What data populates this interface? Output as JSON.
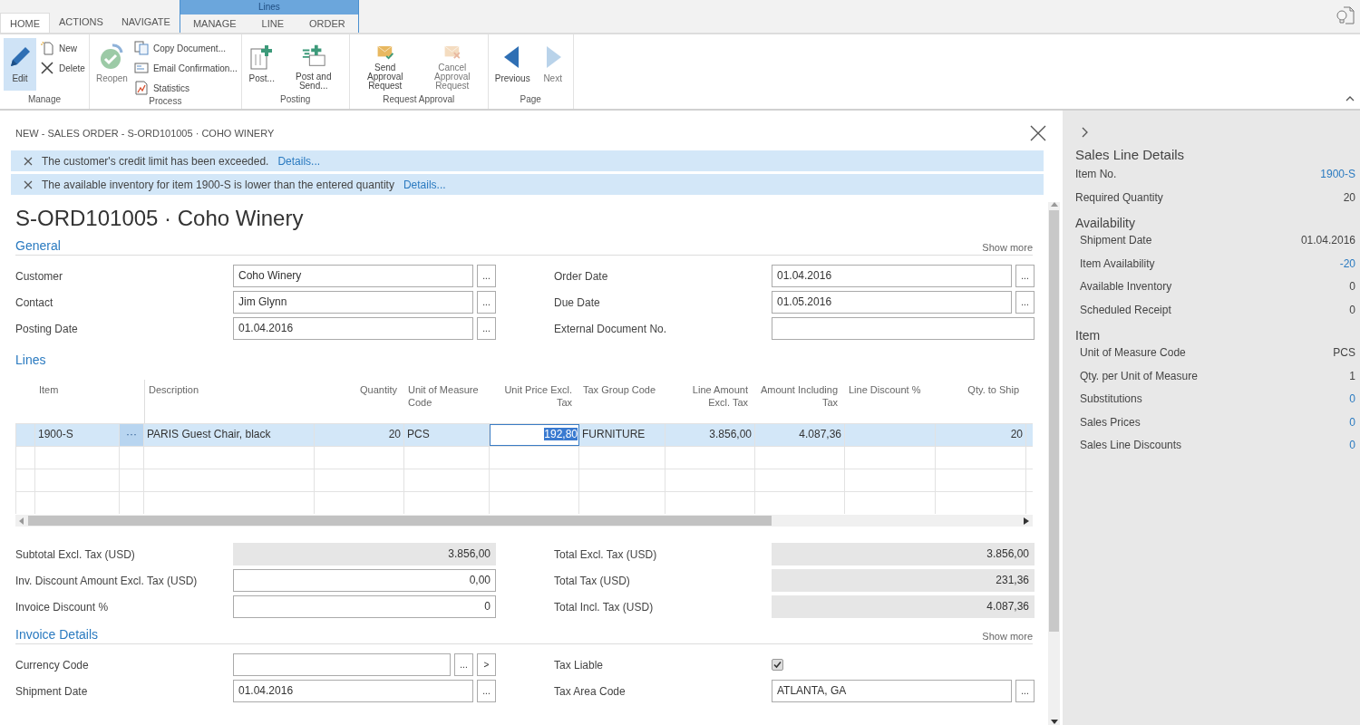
{
  "ribbon": {
    "tabs": [
      {
        "label": "HOME",
        "selected": true
      },
      {
        "label": "ACTIONS",
        "selected": false
      },
      {
        "label": "NAVIGATE",
        "selected": false
      }
    ],
    "context_tabs": {
      "title": "Lines",
      "tabs": [
        {
          "label": "MANAGE",
          "selected": false
        },
        {
          "label": "LINE",
          "selected": false
        },
        {
          "label": "ORDER",
          "selected": false
        }
      ]
    },
    "groups": [
      {
        "label": "Manage",
        "actions": [
          {
            "label": "Edit",
            "large": true,
            "kind": "pencil",
            "selected": true,
            "disabled": false
          },
          {
            "label": "New",
            "large": false,
            "kind": "new"
          },
          {
            "label": "Delete",
            "large": false,
            "kind": "delete"
          }
        ]
      },
      {
        "label": "Process",
        "actions": [
          {
            "label": "Reopen",
            "large": true,
            "kind": "reopen",
            "selected": false,
            "disabled": true
          },
          {
            "label": "Copy Document...",
            "large": false,
            "kind": "copy"
          },
          {
            "label": "Email Confirmation...",
            "large": false,
            "kind": "email"
          },
          {
            "label": "Statistics",
            "large": false,
            "kind": "stats"
          }
        ]
      },
      {
        "label": "Posting",
        "actions": [
          {
            "label": "Post...",
            "large": true,
            "kind": "post",
            "selected": false,
            "disabled": false
          },
          {
            "label": "Post and Send...",
            "large": true,
            "kind": "postsend",
            "selected": false,
            "disabled": false
          }
        ]
      },
      {
        "label": "Request Approval",
        "actions": [
          {
            "label": "Send Approval Request",
            "large": true,
            "kind": "sendapproval",
            "selected": false,
            "disabled": false
          },
          {
            "label": "Cancel Approval Request",
            "large": true,
            "kind": "cancelapproval",
            "selected": false,
            "disabled": true
          }
        ]
      },
      {
        "label": "Page",
        "actions": [
          {
            "label": "Previous",
            "large": true,
            "kind": "prev",
            "selected": false,
            "disabled": false
          },
          {
            "label": "Next",
            "large": true,
            "kind": "next",
            "selected": false,
            "disabled": true
          }
        ]
      }
    ]
  },
  "breadcrumb": "NEW - SALES ORDER - S-ORD101005 · COHO WINERY",
  "notifications": [
    {
      "text": "The customer's credit limit has been exceeded.",
      "link": "Details..."
    },
    {
      "text": "The available inventory for item 1900-S is lower than the entered quantity",
      "link": "Details..."
    }
  ],
  "title": "S-ORD101005 · Coho Winery",
  "general": {
    "heading": "General",
    "show_more": "Show more",
    "fields": [
      {
        "label": "Customer",
        "value": "Coho Winery",
        "lookup": "..."
      },
      {
        "label": "Order Date",
        "value": "01.04.2016",
        "lookup": "..."
      },
      {
        "label": "Contact",
        "value": "Jim Glynn",
        "lookup": "..."
      },
      {
        "label": "Due Date",
        "value": "01.05.2016",
        "lookup": "..."
      },
      {
        "label": "Posting Date",
        "value": "01.04.2016",
        "lookup": "..."
      },
      {
        "label": "External Document No."
      }
    ]
  },
  "lines": {
    "heading": "Lines",
    "columns": [
      {
        "label": "Item",
        "right_aligned": false
      },
      {
        "right_aligned": false
      },
      {
        "label": "Description",
        "right_aligned": false
      },
      {
        "label": "Quantity",
        "right_aligned": true
      },
      {
        "label": "Unit of Measure Code",
        "right_aligned": false
      },
      {
        "label": "Unit Price Excl. Tax",
        "right_aligned": true
      },
      {
        "label": "Tax Group Code",
        "right_aligned": false
      },
      {
        "label": "Line Amount Excl. Tax",
        "right_aligned": true
      },
      {
        "label": "Amount Including Tax",
        "right_aligned": true
      },
      {
        "label": "Line Discount %",
        "right_aligned": false
      },
      {
        "label": "Qty. to Ship",
        "right_aligned": true
      }
    ],
    "rows": [
      {
        "selected": true,
        "cells": [
          {
            "value": "1900-S",
            "focused": false
          },
          {
            "value": "···",
            "focused": false
          },
          {
            "value": "PARIS Guest Chair, black",
            "focused": false
          },
          {
            "value": "20",
            "focused": false
          },
          {
            "value": "PCS",
            "focused": false
          },
          {
            "value": "192,80",
            "focused": true
          },
          {
            "value": "FURNITURE",
            "focused": false
          },
          {
            "value": "3.856,00",
            "focused": false
          },
          {
            "value": "4.087,36",
            "focused": false
          },
          null,
          {
            "value": "20",
            "focused": false
          }
        ]
      }
    ]
  },
  "totals": [
    {
      "label": "Subtotal Excl. Tax (USD)",
      "value": "3.856,00",
      "editable": false
    },
    {
      "label": "Total Excl. Tax (USD)",
      "value": "3.856,00",
      "editable": false
    },
    {
      "label": "Inv. Discount Amount Excl. Tax (USD)",
      "value": "0,00",
      "editable": true
    },
    {
      "label": "Total Tax (USD)",
      "value": "231,36",
      "editable": false
    },
    {
      "label": "Invoice Discount %",
      "value": "0",
      "editable": true
    },
    {
      "label": "Total Incl. Tax (USD)",
      "value": "4.087,36",
      "editable": false
    }
  ],
  "invoice_details": {
    "heading": "Invoice Details",
    "show_more": "Show more",
    "fields": [
      {
        "label": "Currency Code",
        "kind": "text",
        "lookup": "...",
        "drilldown": ">"
      },
      {
        "label": "Tax Liable",
        "kind": "checkbox",
        "checked": true
      },
      {
        "label": "Shipment Date",
        "kind": "text",
        "value": "01.04.2016",
        "lookup": "..."
      },
      {
        "label": "Tax Area Code",
        "kind": "text",
        "value": "ATLANTA, GA",
        "lookup": "..."
      }
    ]
  },
  "factbox": {
    "title": "Sales Line Details",
    "groups": [
      {
        "rows": [
          {
            "label": "Item No.",
            "value": "1900-S",
            "link": true
          },
          {
            "label": "Required Quantity",
            "value": "20",
            "link": false
          }
        ]
      },
      {
        "heading": "Availability",
        "rows": [
          {
            "label": "Shipment Date",
            "value": "01.04.2016",
            "link": false
          },
          {
            "label": "Item Availability",
            "value": "-20",
            "link": true
          },
          {
            "label": "Available Inventory",
            "value": "0",
            "link": false
          },
          {
            "label": "Scheduled Receipt",
            "value": "0",
            "link": false
          }
        ]
      },
      {
        "heading": "Item",
        "rows": [
          {
            "label": "Unit of Measure Code",
            "value": "PCS",
            "link": false
          },
          {
            "label": "Qty. per Unit of Measure",
            "value": "1",
            "link": false
          },
          {
            "label": "Substitutions",
            "value": "0",
            "link": true
          },
          {
            "label": "Sales Prices",
            "value": "0",
            "link": true
          },
          {
            "label": "Sales Line Discounts",
            "value": "0",
            "link": true
          }
        ]
      }
    ]
  }
}
